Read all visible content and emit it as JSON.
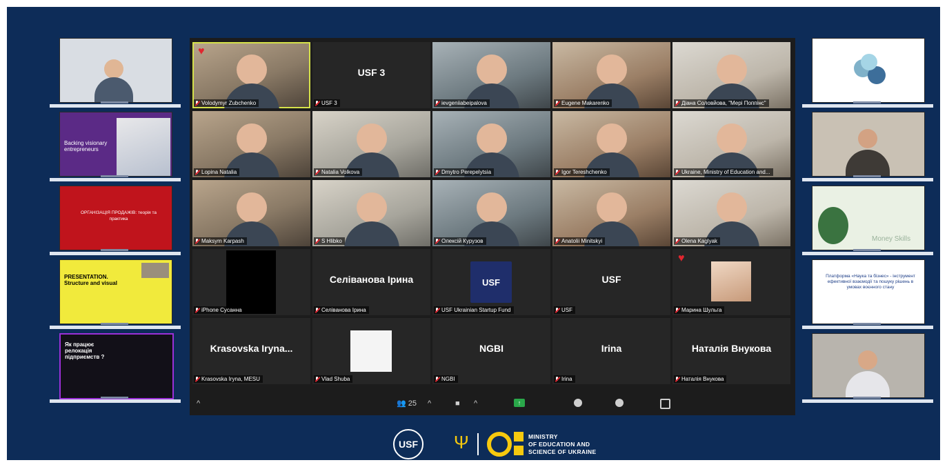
{
  "participants": [
    {
      "name": "Volodymyr Zubchenko",
      "style": "video"
    },
    {
      "name": "USF 3",
      "big": "USF 3",
      "style": "avatar"
    },
    {
      "name": "ievgeniiabeipalova",
      "style": "video"
    },
    {
      "name": "Eugene Makarenko",
      "style": "video"
    },
    {
      "name": "Дiана Соловйова, \"Мерi Поппiнс\"",
      "style": "video"
    },
    {
      "name": "Lopina Natalia",
      "style": "video"
    },
    {
      "name": "Natalia Volkova",
      "style": "video"
    },
    {
      "name": "Dmytro Perepelytsia",
      "style": "video"
    },
    {
      "name": "Igor Tereshchenko",
      "style": "video"
    },
    {
      "name": "Ukraine, Ministry of Education and...",
      "style": "video"
    },
    {
      "name": "Maksym Karpash",
      "style": "video"
    },
    {
      "name": "S Hlibko",
      "style": "video"
    },
    {
      "name": "Олексiй Курузов",
      "style": "video"
    },
    {
      "name": "Anatolii Minitskyi",
      "style": "video"
    },
    {
      "name": "Olena Kaglyak",
      "style": "video"
    },
    {
      "name": "iPhone Сусанна",
      "style": "black"
    },
    {
      "name": "Селiванова Ірина",
      "big": "Селiванова Ірина",
      "style": "avatar"
    },
    {
      "name": "USF Ukrainian Startup Fund",
      "logo": "USF",
      "style": "logo"
    },
    {
      "name": "USF",
      "big": "USF",
      "style": "avatar"
    },
    {
      "name": "Марина Шульга",
      "style": "photo"
    },
    {
      "name": "Krasovska Iryna, MESU",
      "big": "Krasovska Iryna...",
      "style": "avatar"
    },
    {
      "name": "Vlad Shuba",
      "style": "white"
    },
    {
      "name": "NGBI",
      "big": "NGBI",
      "style": "avatar"
    },
    {
      "name": "Irina",
      "big": "Irina",
      "style": "avatar"
    },
    {
      "name": "Наталiя Внукова",
      "big": "Наталiя Внукова",
      "style": "avatar"
    }
  ],
  "toolbar": {
    "participant_count": "25",
    "caret": "^"
  },
  "left_slides": [
    {
      "title": "",
      "style": "speaker"
    },
    {
      "title": "Backing visionary entrepreneurs",
      "style": "purple"
    },
    {
      "title": "ОРГАНІЗАЦІЯ ПРОДАЖІВ: теорія та практика",
      "style": "red"
    },
    {
      "title": "PRESENTATION. Structure and visual",
      "style": "yellow"
    },
    {
      "title": "Як працює релокація підприємств ?",
      "style": "dark"
    }
  ],
  "right_slides": [
    {
      "title": "",
      "style": "diagram"
    },
    {
      "title": "",
      "style": "speaker"
    },
    {
      "title": "Money Skills",
      "style": "money"
    },
    {
      "title": "Платформа «Наука та бізнес» - інструмент ефективної взаємодії та пошуку рішень в умовах воєнного стану",
      "style": "platform"
    },
    {
      "title": "",
      "style": "speaker"
    }
  ],
  "footer": {
    "usf_logo": "USF",
    "ministry_line1": "MINISTRY",
    "ministry_line2": "OF EDUCATION AND",
    "ministry_line3": "SCIENCE OF UKRAINE"
  },
  "colors": {
    "frame": "#0d2c58",
    "accent": "#f6c90e",
    "mute": "#e0262f",
    "active_speaker": "#d6e24a"
  }
}
